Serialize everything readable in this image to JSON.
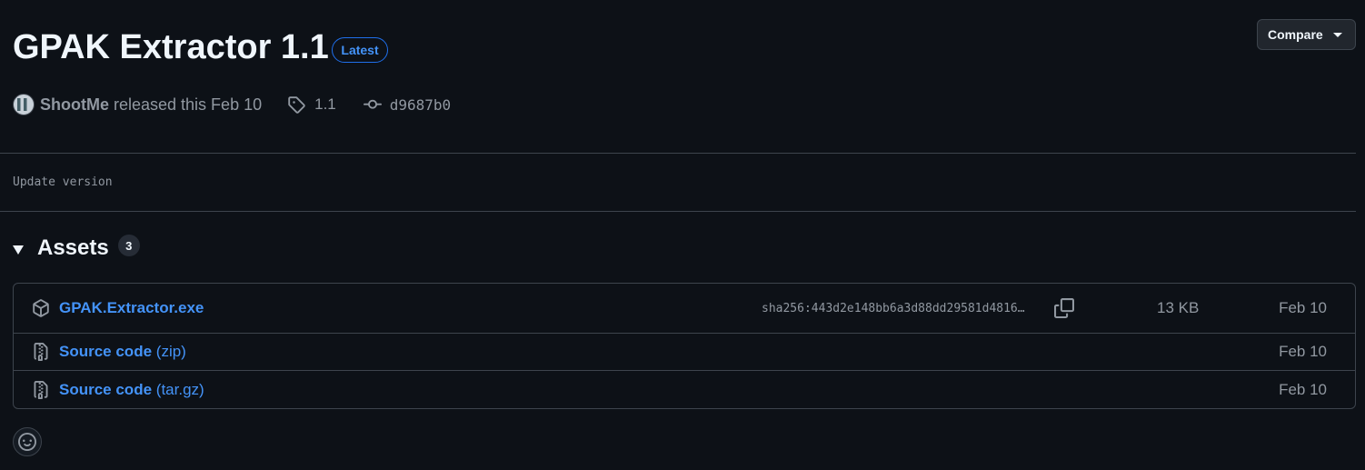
{
  "release": {
    "title": "GPAK Extractor 1.1",
    "badge": "Latest",
    "compare_label": "Compare",
    "author": "ShootMe",
    "released_text": "released this Feb 10",
    "tag": "1.1",
    "commit": "d9687b0",
    "notes": "Update version"
  },
  "assets": {
    "title": "Assets",
    "count": "3",
    "items": [
      {
        "name": "GPAK.Extractor.exe",
        "sha": "sha256:443d2e148bb6a3d88dd29581d4816…",
        "size": "13 KB",
        "date": "Feb 10",
        "icon": "package-icon"
      },
      {
        "name": "Source code",
        "ext": "(zip)",
        "date": "Feb 10",
        "icon": "file-zip-icon"
      },
      {
        "name": "Source code",
        "ext": "(tar.gz)",
        "date": "Feb 10",
        "icon": "file-zip-icon"
      }
    ]
  },
  "colors": {
    "background": "#0d1117",
    "link": "#4493f8",
    "muted": "#9198a1",
    "border": "#3d444d"
  }
}
